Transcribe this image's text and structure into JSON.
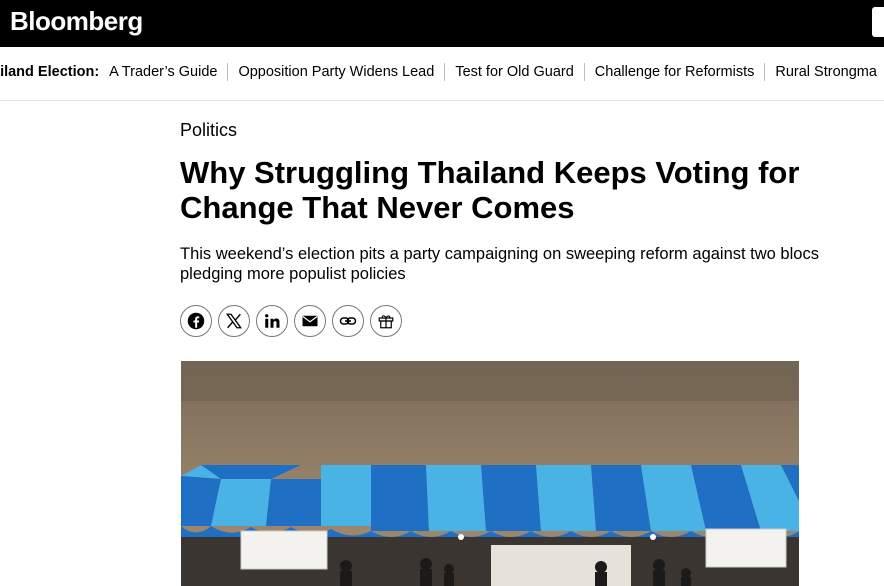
{
  "header": {
    "logo_text": "Bloomberg"
  },
  "subnav": {
    "label": "ailand Election:",
    "links": [
      "A Trader’s Guide",
      "Opposition Party Widens Lead",
      "Test for Old Guard",
      "Challenge for Reformists",
      "Rural Strongma"
    ]
  },
  "article": {
    "kicker": "Politics",
    "headline": "Why Struggling Thailand Keeps Voting for Change That Never Comes",
    "dek": "This weekend’s election pits a party campaigning on sweeping reform against two blocs pledging more populist policies"
  },
  "share": {
    "icons": [
      "facebook-icon",
      "x-icon",
      "linkedin-icon",
      "email-icon",
      "link-icon",
      "gift-icon"
    ]
  },
  "colors": {
    "topbar": "#000000",
    "text": "#000000",
    "tent_dark_blue": "#1f6fc4",
    "tent_light_blue": "#4ab3e6",
    "wall": "#8d7a62"
  }
}
